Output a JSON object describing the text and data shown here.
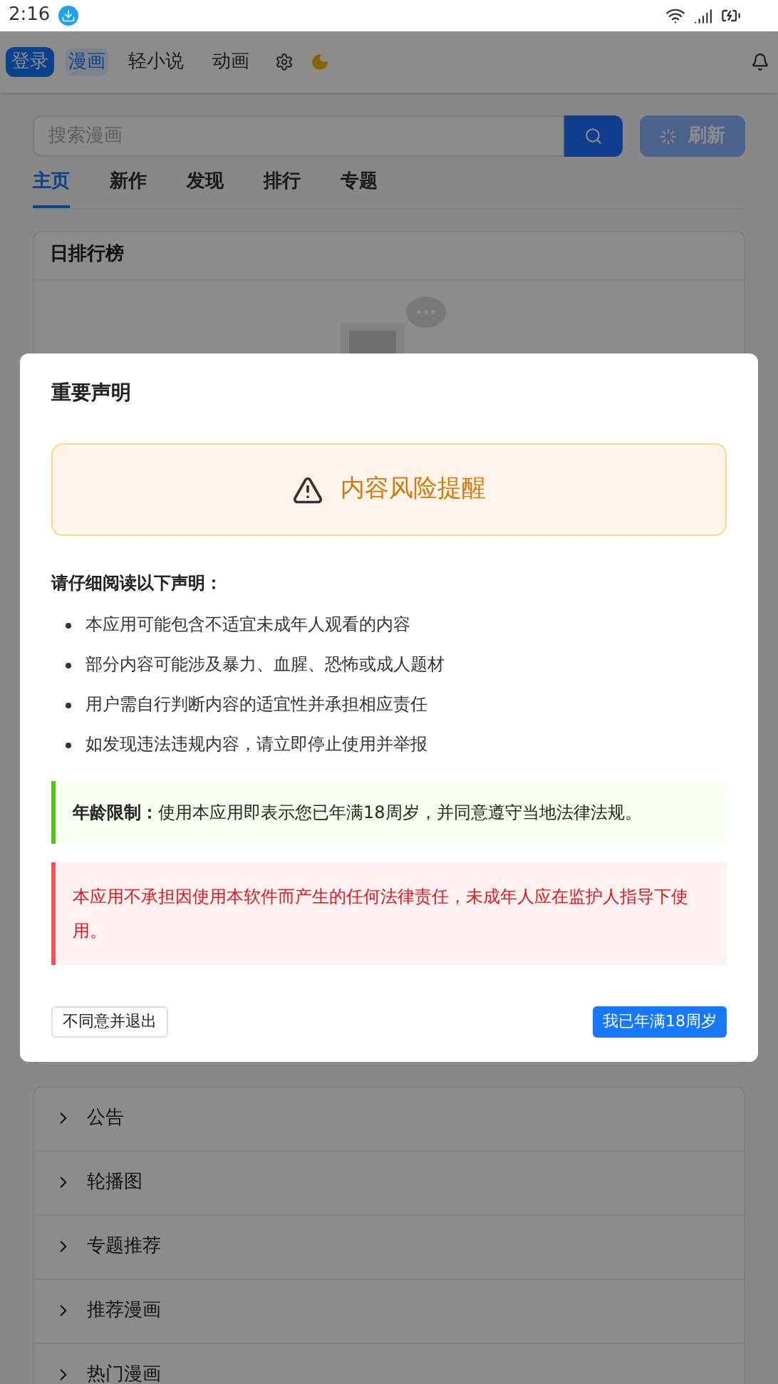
{
  "status_bar": {
    "time": "2:16"
  },
  "nav": {
    "login": "登录",
    "items": [
      {
        "label": "漫画",
        "selected": true
      },
      {
        "label": "轻小说",
        "selected": false
      },
      {
        "label": "动画",
        "selected": false
      }
    ]
  },
  "search": {
    "placeholder": "搜索漫画",
    "refresh": {
      "label": "刷新",
      "loading": true
    }
  },
  "tabs": [
    {
      "label": "主页",
      "selected": true
    },
    {
      "label": "新作",
      "selected": false
    },
    {
      "label": "发现",
      "selected": false
    },
    {
      "label": "排行",
      "selected": false
    },
    {
      "label": "专题",
      "selected": false
    }
  ],
  "ranking_card": {
    "title": "日排行榜"
  },
  "sections": [
    {
      "label": "公告",
      "expanded": false
    },
    {
      "label": "轮播图",
      "expanded": false
    },
    {
      "label": "专题推荐",
      "expanded": false
    },
    {
      "label": "推荐漫画",
      "expanded": false
    },
    {
      "label": "热门漫画",
      "expanded": false
    }
  ],
  "dialog": {
    "title": "重要声明",
    "alert": "内容风险提醒",
    "intro": "请仔细阅读以下声明：",
    "bullets": [
      "本应用可能包含不适宜未成年人观看的内容",
      "部分内容可能涉及暴力、血腥、恐怖或成人题材",
      "用户需自行判断内容的适宜性并承担相应责任",
      "如发现违法违规内容，请立即停止使用并举报"
    ],
    "notices": [
      {
        "kind": "success",
        "text": "**年龄限制：**使用本应用即表示您已年满18周岁，并同意遵守当地法律法规。"
      },
      {
        "kind": "danger",
        "text": "本应用不承担因使用本软件而产生的任何法律责任，未成年人应在监护人指导下使用。"
      }
    ],
    "decline": "不同意并退出",
    "accept": "我已年满18周岁"
  }
}
